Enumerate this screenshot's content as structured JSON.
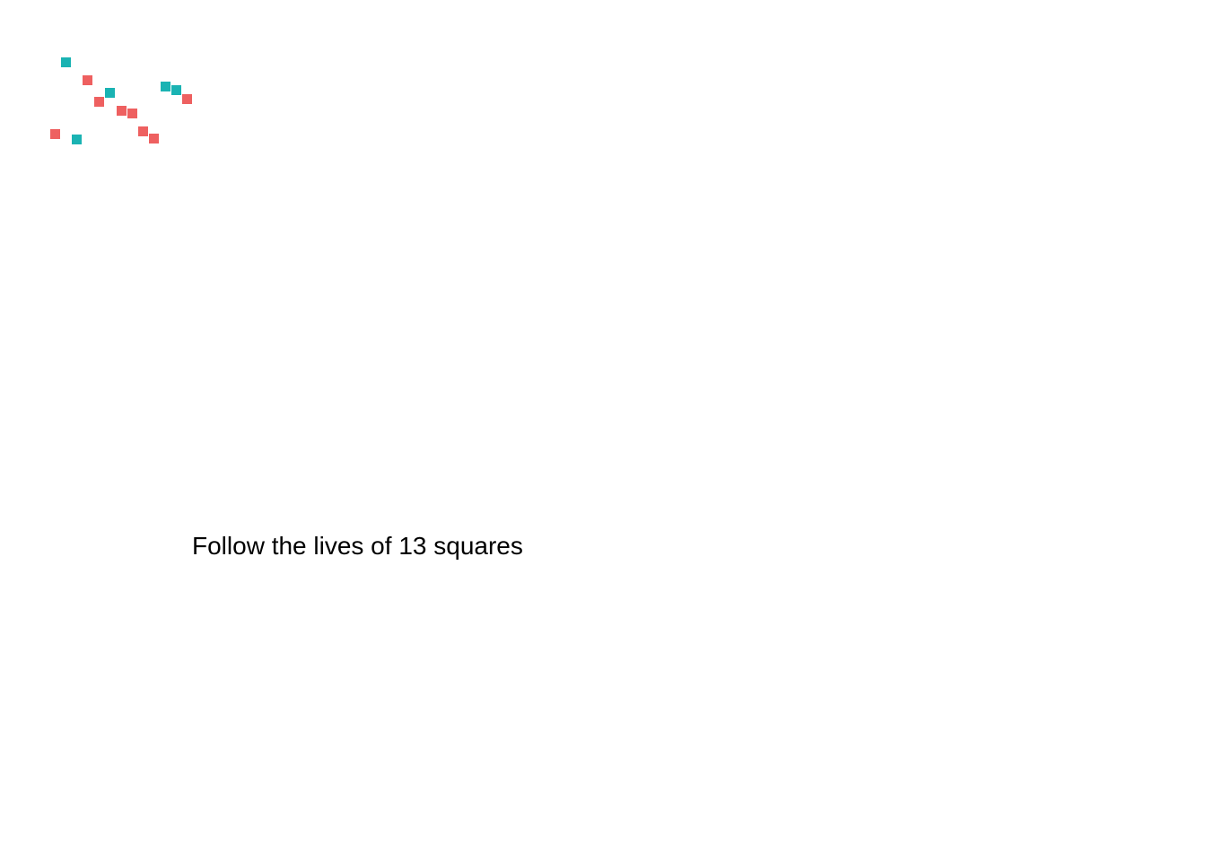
{
  "caption": "Follow the lives of 13 squares",
  "colors": {
    "teal": "#1ab3b3",
    "coral": "#ee6060"
  },
  "squares": [
    {
      "color": "teal"
    },
    {
      "color": "coral"
    },
    {
      "color": "teal"
    },
    {
      "color": "coral"
    },
    {
      "color": "coral"
    },
    {
      "color": "coral"
    },
    {
      "color": "teal"
    },
    {
      "color": "teal"
    },
    {
      "color": "coral"
    },
    {
      "color": "coral"
    },
    {
      "color": "coral"
    },
    {
      "color": "teal"
    },
    {
      "color": "coral"
    }
  ]
}
